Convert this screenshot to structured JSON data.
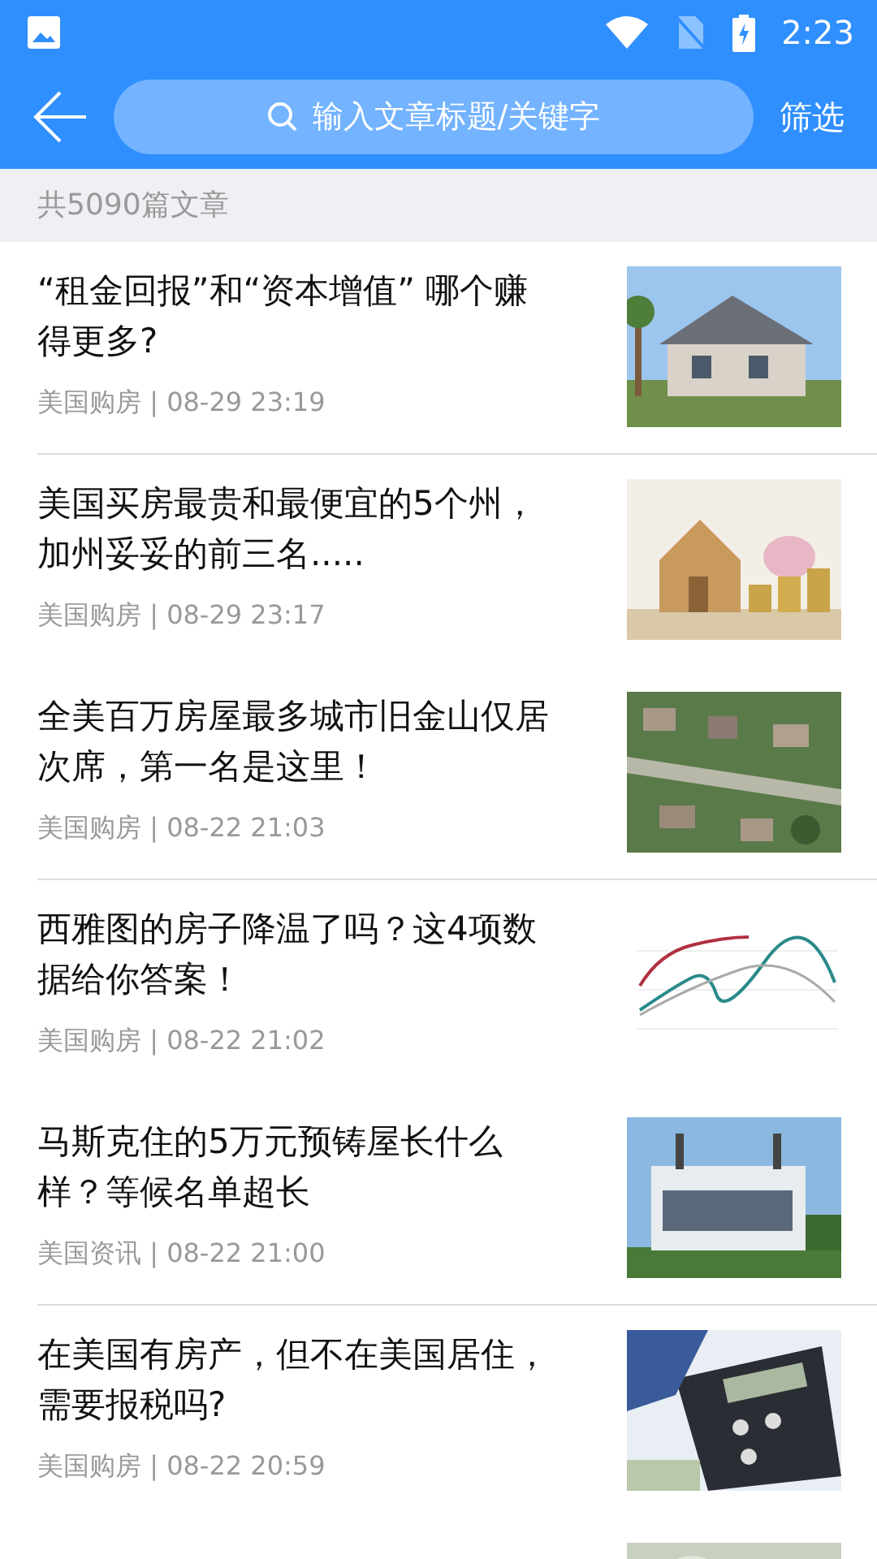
{
  "status_bar": {
    "time": "2:23"
  },
  "toolbar": {
    "search": {
      "placeholder": "输入文章标题/关键字"
    },
    "filter": "筛选"
  },
  "count": "共5090篇文章",
  "articles": [
    {
      "title": "“租金回报”和“资本增值” 哪个赚得更多?",
      "source": "美国购房 | 08-29 23:19",
      "picture": {
        "kind": "picture"
      },
      "divider": true
    },
    {
      "title": "美国买房最贵和最便宜的5个州，加州妥妥的前三名.....",
      "source": "美国购房 | 08-29 23:17",
      "picture": {
        "kind": "picture"
      },
      "divider": false
    },
    {
      "title": "全美百万房屋最多城市旧金山仅居次席，第一名是这里！",
      "source": "美国购房 | 08-22 21:03",
      "picture": {
        "kind": "picture"
      },
      "divider": true
    },
    {
      "title": "西雅图的房子降温了吗？这4项数据给你答案！",
      "source": "美国购房 | 08-22 21:02",
      "picture": {
        "kind": "picture"
      },
      "divider": false
    },
    {
      "title": "马斯克住的5万元预铸屋长什么样？等候名单超长",
      "source": "美国资讯 | 08-22 21:00",
      "picture": {
        "kind": "picture"
      },
      "divider": true
    },
    {
      "title": "在美国有房产，但不在美国居住，需要报税吗?",
      "source": "美国购房 | 08-22 20:59",
      "picture": {
        "kind": "picture"
      },
      "divider": false
    },
    {
      "picture": {
        "kind": "picture"
      }
    }
  ]
}
